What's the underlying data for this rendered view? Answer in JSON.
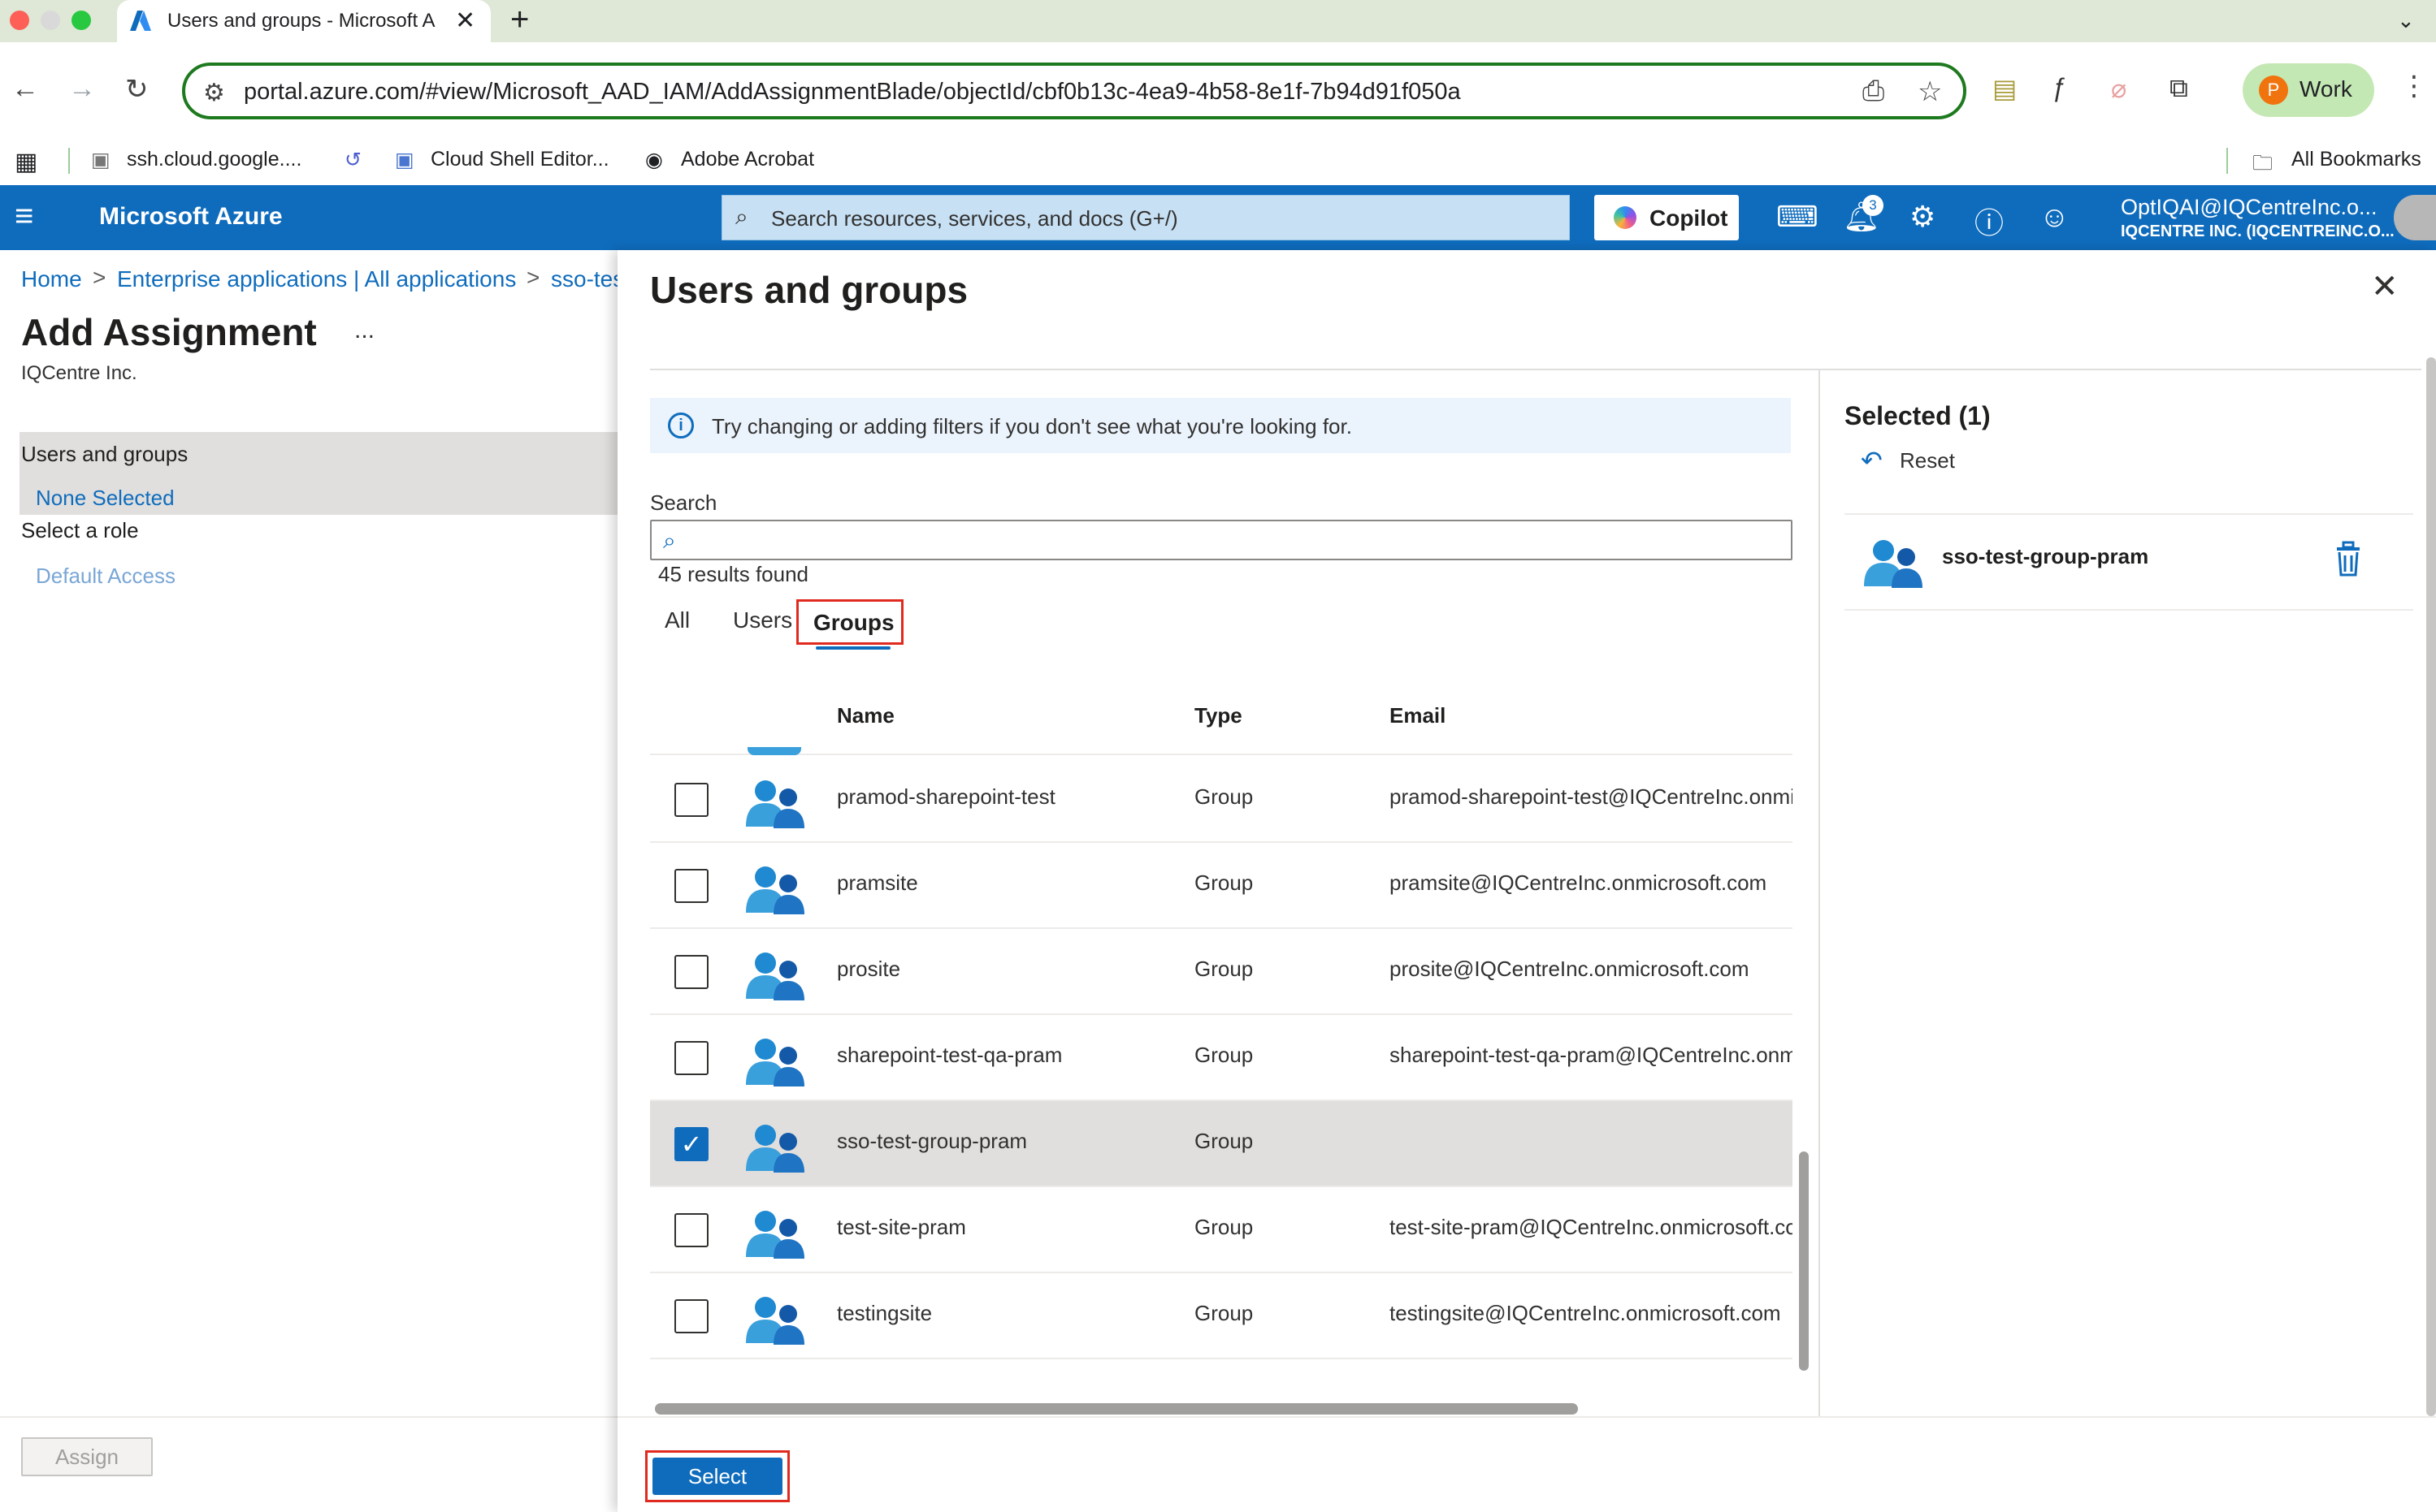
{
  "browser": {
    "tab_title": "Users and groups - Microsoft Azure",
    "tab_close": "✕",
    "new_tab": "+",
    "url": "portal.azure.com/#view/Microsoft_AAD_IAM/AddAssignmentBlade/objectId/cbf0b13c-4ea9-4b58-8e1f-7b94d91f050a",
    "profile_initial": "P",
    "profile_label": "Work",
    "bookmarks": [
      "ssh.cloud.google....",
      "Cloud Shell Editor...",
      "Adobe Acrobat"
    ],
    "all_bookmarks": "All Bookmarks"
  },
  "azure_header": {
    "brand": "Microsoft Azure",
    "search_placeholder": "Search resources, services, and docs (G+/)",
    "copilot_label": "Copilot",
    "notification_count": "3",
    "account_name": "OptIQAI@IQCentreInc.o...",
    "account_tenant": "IQCENTRE INC. (IQCENTREINC.O..."
  },
  "breadcrumb": {
    "items": [
      "Home",
      "Enterprise applications | All applications",
      "sso-tes"
    ],
    "separator": ">"
  },
  "add_assignment": {
    "title": "Add Assignment",
    "more": "...",
    "subtitle": "IQCentre Inc.",
    "step1_label": "Users and groups",
    "step1_value": "None Selected",
    "step2_label": "Select a role",
    "step2_value": "Default Access",
    "assign_label": "Assign"
  },
  "users_groups": {
    "title": "Users and groups",
    "close": "✕",
    "info": "Try changing or adding filters if you don't see what you're looking for.",
    "search_label": "Search",
    "search_value": "",
    "results": "45 results found",
    "tabs": [
      "All",
      "Users",
      "Groups"
    ],
    "active_tab": "Groups",
    "columns": {
      "name": "Name",
      "type": "Type",
      "email": "Email"
    },
    "rows": [
      {
        "name": "pramod-sharepoint-test",
        "type": "Group",
        "email": "pramod-sharepoint-test@IQCentreInc.onmi",
        "checked": false
      },
      {
        "name": "pramsite",
        "type": "Group",
        "email": "pramsite@IQCentreInc.onmicrosoft.com",
        "checked": false
      },
      {
        "name": "prosite",
        "type": "Group",
        "email": "prosite@IQCentreInc.onmicrosoft.com",
        "checked": false
      },
      {
        "name": "sharepoint-test-qa-pram",
        "type": "Group",
        "email": "sharepoint-test-qa-pram@IQCentreInc.onm",
        "checked": false
      },
      {
        "name": "sso-test-group-pram",
        "type": "Group",
        "email": "",
        "checked": true
      },
      {
        "name": "test-site-pram",
        "type": "Group",
        "email": "test-site-pram@IQCentreInc.onmicrosoft.co",
        "checked": false
      },
      {
        "name": "testingsite",
        "type": "Group",
        "email": "testingsite@IQCentreInc.onmicrosoft.com",
        "checked": false
      }
    ],
    "selected_title": "Selected (1)",
    "reset_label": "Reset",
    "selected_items": [
      "sso-test-group-pram"
    ],
    "select_label": "Select"
  },
  "colors": {
    "azure_blue": "#0f6cbd",
    "highlight_red": "#e0291f",
    "selected_row": "#e1dfdd"
  }
}
